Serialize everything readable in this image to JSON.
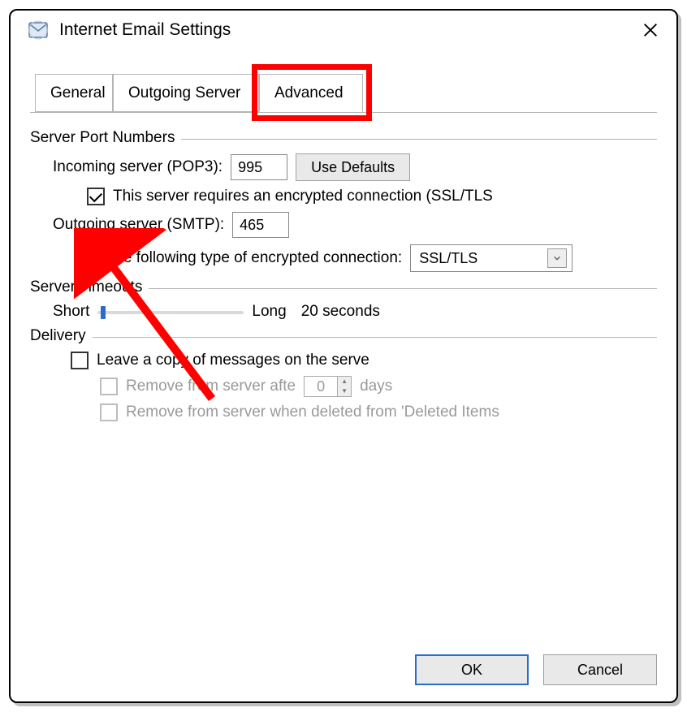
{
  "window": {
    "title": "Internet Email Settings"
  },
  "tabs": {
    "general": "General",
    "outgoing": "Outgoing Server",
    "advanced": "Advanced",
    "active": "advanced"
  },
  "server_ports": {
    "group_label": "Server Port Numbers",
    "incoming_label": "Incoming server (POP3):",
    "incoming_value": "995",
    "use_defaults": "Use Defaults",
    "ssl_checkbox_label": "This server requires an encrypted connection (SSL/TLS",
    "ssl_checked": true,
    "outgoing_label": "Outgoing server (SMTP):",
    "outgoing_value": "465",
    "enc_type_label": "Use the following type of encrypted connection:",
    "enc_type_value": "SSL/TLS"
  },
  "timeouts": {
    "group_label": "Server Timeouts",
    "short_label": "Short",
    "long_label": "Long",
    "value_label": "20 seconds"
  },
  "delivery": {
    "group_label": "Delivery",
    "leave_copy_label": "Leave a copy of messages on the serve",
    "leave_copy_checked": false,
    "remove_after_label": "Remove from server afte",
    "remove_after_days_value": "0",
    "remove_after_days_unit": "days",
    "remove_deleted_label": "Remove from server when deleted from 'Deleted Items"
  },
  "footer": {
    "ok": "OK",
    "cancel": "Cancel"
  },
  "annotations": {
    "highlight_tab": "advanced",
    "arrow_target": "ssl-checkbox"
  }
}
